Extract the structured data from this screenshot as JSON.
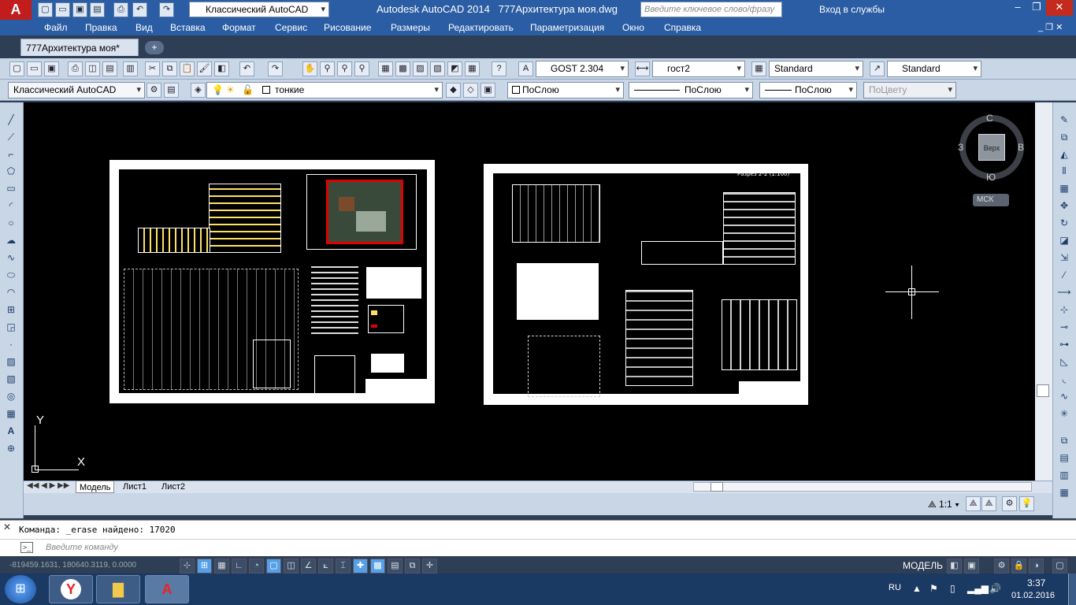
{
  "title": {
    "app_button": "A",
    "workspace": "Классический AutoCAD",
    "app_title": "Autodesk AutoCAD 2014",
    "doc_title": "777Архитектура моя.dwg",
    "search_placeholder": "Введите ключевое слово/фразу",
    "login": "Вход в службы"
  },
  "menu": [
    "Файл",
    "Правка",
    "Вид",
    "Вставка",
    "Формат",
    "Сервис",
    "Рисование",
    "Размеры",
    "Редактировать",
    "Параметризация",
    "Окно",
    "Справка"
  ],
  "doc_tab": "777Архитектура моя*",
  "styles": {
    "text_style": "GOST 2.304",
    "dim_style": "гост2",
    "table_style": "Standard",
    "mleader_style": "Standard"
  },
  "layers": {
    "workspace2": "Классический AutoCAD",
    "layer": "тонкие",
    "color": "ПоСлою",
    "linetype": "ПоСлою",
    "lineweight": "ПоСлою",
    "plotstyle": "ПоЦвету"
  },
  "viewcube": {
    "north": "С",
    "south": "Ю",
    "west": "З",
    "east": "В",
    "face": "Верх",
    "ucs": "МСК"
  },
  "ucs": {
    "x": "X",
    "y": "Y"
  },
  "layout_tabs": [
    "Модель",
    "Лист1",
    "Лист2"
  ],
  "sheet2_title": "Разрез 2-2 (1:100)",
  "annotation_scale": "1:1",
  "command": {
    "history": "Команда: _erase найдено: 17020",
    "placeholder": "Введите команду"
  },
  "status": {
    "coords": "-819459.1631, 180640.3119, 0.0000",
    "model": "МОДЕЛЬ"
  },
  "taskbar": {
    "lang": "RU",
    "time": "3:37",
    "date": "01.02.2016"
  },
  "colors": {
    "title_bg": "#2a5da3",
    "canvas": "#000000",
    "toolbar": "#c9d6e6",
    "accent_red": "#c21c1c"
  }
}
